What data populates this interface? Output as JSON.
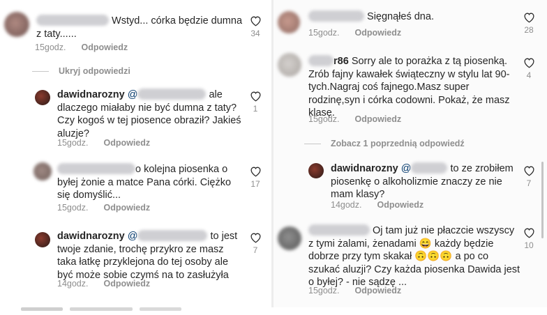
{
  "left": {
    "comments": [
      {
        "text_after": "Wstyd... córka będzie dumna z taty......",
        "time": "15godz.",
        "reply": "Odpowiedz",
        "likes": "34"
      },
      {
        "toggle": "Ukryj odpowiedzi"
      },
      {
        "user": "dawidnarozny",
        "mention": "@",
        "text_after": "ale dlaczego miałaby nie być dumna z taty? Czy kogoś w tej piosence obraził? Jakieś aluzje?",
        "time": "15godz.",
        "reply": "Odpowiedz",
        "likes": "1"
      },
      {
        "text_after": "o kolejna piosenka o byłej żonie a matce Pana córki.  Ciężko się domyślić...",
        "time": "15godz.",
        "reply": "Odpowiedz",
        "likes": "17"
      },
      {
        "user": "dawidnarozny",
        "mention": "@",
        "text_after": "to jest twoje zdanie, trochę przykro ze masz taka łatkę przyklejona do tej osoby ale być może sobie czymś na to zasłużyła",
        "time": "14godz.",
        "reply": "Odpowiedz",
        "likes": "7"
      }
    ]
  },
  "right": {
    "comments": [
      {
        "text_after": "Sięgnąłeś dna.",
        "time": "15godz.",
        "reply": "Odpowiedz",
        "likes": "28"
      },
      {
        "user_tail": "r86",
        "text_after": "Sorry ale to porażka z tą piosenką. Zrób fajny kawałek świąteczny w stylu lat 90-tych.Nagraj coś fajnego.Masz super rodzinę,syn i córka codowni. Pokaż, że masz klasę.",
        "time": "15godz.",
        "reply": "Odpowiedz",
        "likes": "4"
      },
      {
        "toggle": "Zobacz 1 poprzednią odpowiedź"
      },
      {
        "user": "dawidnarozny",
        "mention": "@",
        "text_after": "to ze zrobiłem piosenkę o alkoholizmie znaczy ze nie mam klasy?",
        "time": "14godz.",
        "reply": "Odpowiedz",
        "likes": "7"
      },
      {
        "text_after": "Oj tam już nie płaczcie wszyscy z tymi żalami, żenadami 😄 każdy będzie dobrze przy tym skakał 🙃🙃🙃 a po co szukać aluzji? Czy każda piosenka Dawida jest o byłej? - nie sądzę ...",
        "time": "15godz.",
        "reply": "Odpowiedz",
        "likes": "10"
      }
    ]
  },
  "colors": {
    "text": "#262626",
    "meta": "#8e8e8e",
    "mention": "#00376b",
    "background": "#ffffff"
  },
  "icons": {
    "like": "heart-outline-icon"
  }
}
